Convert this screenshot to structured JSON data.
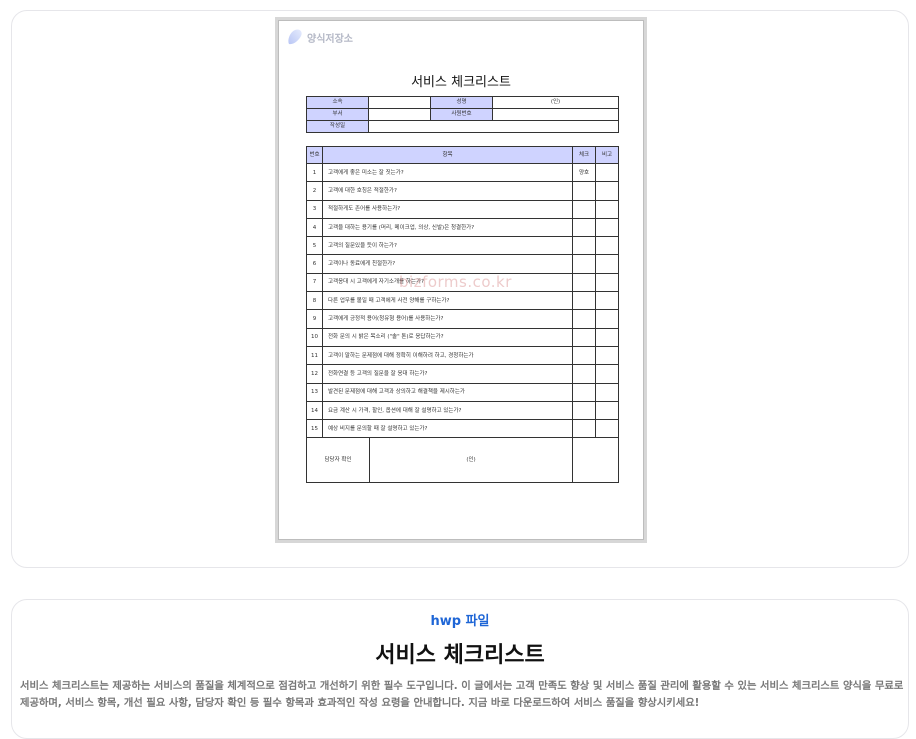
{
  "preview": {
    "logo_text": "양식저장소",
    "doc_title": "서비스 체크리스트",
    "watermark": "bizforms.co.kr",
    "info": {
      "affiliation_label": "소속",
      "name_label": "성명",
      "seal": "(인)",
      "dept_label": "부서",
      "employee_no_label": "사원번호",
      "date_label": "작성일"
    },
    "items_header": {
      "no": "번호",
      "item": "항목",
      "check": "체크",
      "note": "비고"
    },
    "items": [
      {
        "no": "1",
        "text": "고객에게 좋은 미소는 잘 짓는가?",
        "check": "양호"
      },
      {
        "no": "2",
        "text": "고객에 대한 호칭은 적절한가?",
        "check": ""
      },
      {
        "no": "3",
        "text": "적절하게도 존어를 사용하는가?",
        "check": ""
      },
      {
        "no": "4",
        "text": "고객을 대하는 용기를 (머리, 메이크업, 의상, 신발)은 청결한가?",
        "check": ""
      },
      {
        "no": "5",
        "text": "고객의 질문있을 듯이 하는가?",
        "check": ""
      },
      {
        "no": "6",
        "text": "고객이나 동료에게 친절한가?",
        "check": ""
      },
      {
        "no": "7",
        "text": "고객응대 시 고객에게 자기소개를 하는가?",
        "check": ""
      },
      {
        "no": "8",
        "text": "다른 업무를 볼일 때 고객에게 사전 양해를 구하는가?",
        "check": ""
      },
      {
        "no": "9",
        "text": "고객에게 긍정적 용어(청유형 용어)를 사용하는가?",
        "check": ""
      },
      {
        "no": "10",
        "text": "전화 문의 시 밝은 목소리 (\"솔\" 톤)로 응답하는가?",
        "check": ""
      },
      {
        "no": "11",
        "text": "고객이 말하는 문제점에 대해 정확히 이해하려 하고, 경청하는가",
        "check": ""
      },
      {
        "no": "12",
        "text": "전화연결 등 고객의 질문을 잘 응대 하는가?",
        "check": ""
      },
      {
        "no": "13",
        "text": "발견된 문제점에 대해 고객과 상의하고 해결책을 제시하는가",
        "check": ""
      },
      {
        "no": "14",
        "text": "요금 계산 시 가격, 할인, 옵션에 대해 잘 설명하고 있는가?",
        "check": ""
      },
      {
        "no": "15",
        "text": "예상 비지를 문의할 때 잘 설명하고 있는가?",
        "check": ""
      }
    ],
    "sign_label": "담당자 확인",
    "sign_seal": "(인)"
  },
  "info_card": {
    "file_type": "hwp 파일",
    "title": "서비스 체크리스트",
    "description": "서비스 체크리스트는 제공하는 서비스의 품질을 체계적으로 점검하고 개선하기 위한 필수 도구입니다. 이 글에서는 고객 만족도 향상 및 서비스 품질 관리에 활용할 수 있는 서비스 체크리스트 양식을 무료로 제공하며, 서비스 항목, 개선 필요 사항, 담당자 확인 등 필수 항목과 효과적인 작성 요령을 안내합니다. 지금 바로 다운로드하여 서비스 품질을 향상시키세요!"
  }
}
